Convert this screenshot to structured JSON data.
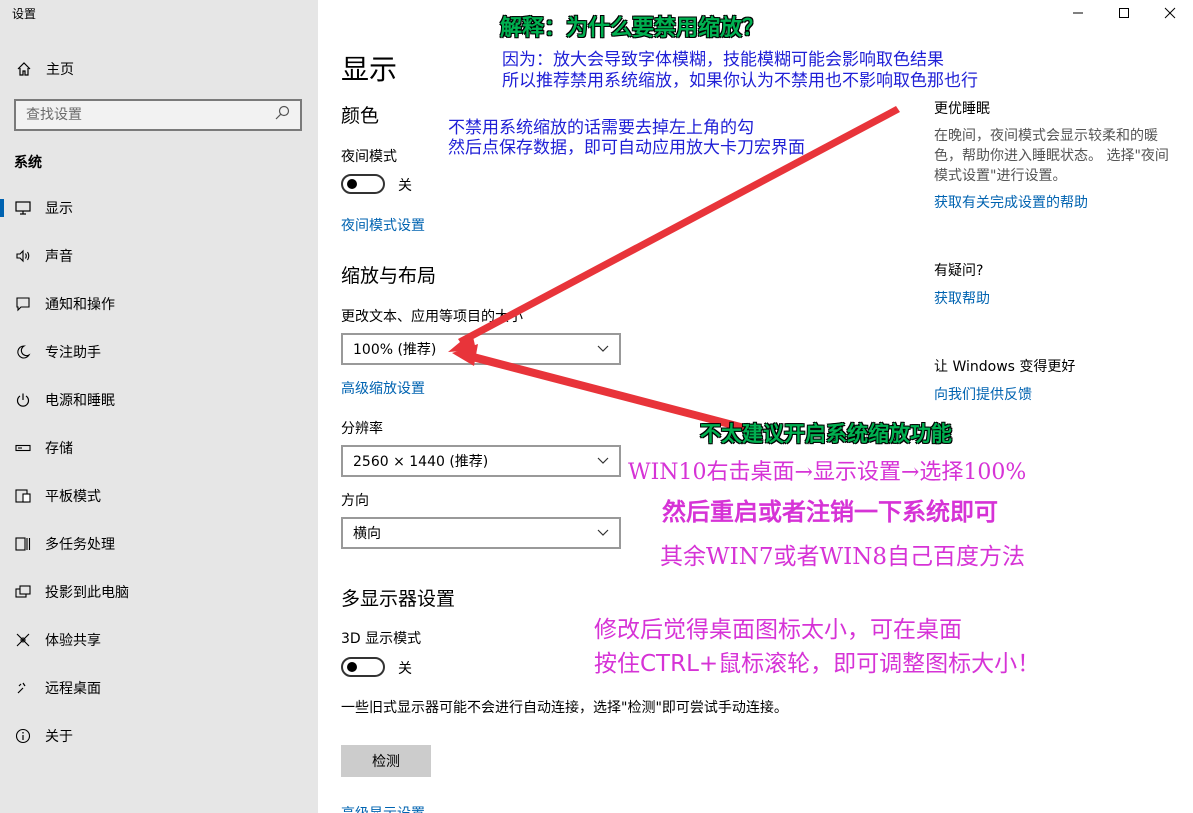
{
  "app": {
    "title": "设置"
  },
  "window": {
    "minimize_icon": "minimize-icon",
    "maximize_icon": "maximize-icon",
    "close_icon": "close-icon"
  },
  "sidebar": {
    "home_label": "主页",
    "search_placeholder": "查找设置",
    "section_label": "系统",
    "items": [
      {
        "label": "显示",
        "icon": "monitor-icon",
        "active": true
      },
      {
        "label": "声音",
        "icon": "speaker-icon"
      },
      {
        "label": "通知和操作",
        "icon": "notification-icon"
      },
      {
        "label": "专注助手",
        "icon": "moon-icon"
      },
      {
        "label": "电源和睡眠",
        "icon": "power-icon"
      },
      {
        "label": "存储",
        "icon": "storage-icon"
      },
      {
        "label": "平板模式",
        "icon": "tablet-icon"
      },
      {
        "label": "多任务处理",
        "icon": "multitask-icon"
      },
      {
        "label": "投影到此电脑",
        "icon": "project-icon"
      },
      {
        "label": "体验共享",
        "icon": "share-icon"
      },
      {
        "label": "远程桌面",
        "icon": "remote-icon"
      },
      {
        "label": "关于",
        "icon": "info-icon"
      }
    ]
  },
  "main": {
    "title": "显示",
    "color_heading": "颜色",
    "night_mode_label": "夜间模式",
    "night_mode_state": "关",
    "night_mode_settings_link": "夜间模式设置",
    "scale_heading": "缩放与布局",
    "scale_label": "更改文本、应用等项目的大小",
    "scale_value": "100% (推荐)",
    "advanced_scale_link": "高级缩放设置",
    "resolution_label": "分辨率",
    "resolution_value": "2560 × 1440 (推荐)",
    "orientation_label": "方向",
    "orientation_value": "横向",
    "multi_display_heading": "多显示器设置",
    "mode3d_label": "3D 显示模式",
    "mode3d_state": "关",
    "legacy_text": "一些旧式显示器可能不会进行自动连接，选择\"检测\"即可尝试手动连接。",
    "detect_button": "检测",
    "advanced_display_link": "高级显示设置"
  },
  "right": {
    "sleep_heading": "更优睡眠",
    "sleep_text": "在晚间，夜间模式会显示较柔和的暖色，帮助你进入睡眠状态。 选择\"夜间模式设置\"进行设置。",
    "sleep_link": "获取有关完成设置的帮助",
    "question_heading": "有疑问?",
    "help_link": "获取帮助",
    "improve_heading": "让 Windows 变得更好",
    "feedback_link": "向我们提供反馈"
  },
  "annotations": {
    "why_title": "解释：为什么要禁用缩放？",
    "why_line1": "因为：放大会导致字体模糊，技能模糊可能会影响取色结果",
    "why_line2": "所以推荐禁用系统缩放，如果你认为不禁用也不影响取色那也行",
    "tip_line1": "不禁用系统缩放的话需要去掉左上角的勾",
    "tip_line2": "然后点保存数据，即可自动应用放大卡刀宏界面",
    "recommend": "不太建议开启系统缩放功能",
    "win10": "WIN10右击桌面→显示设置→选择100%",
    "restart": "然后重启或者注销一下系统即可",
    "others": "其余WIN7或者WIN8自己百度方法",
    "after1": "修改后觉得桌面图标太小，可在桌面",
    "after2": "按住CTRL+鼠标滚轮，即可调整图标大小！"
  },
  "colors": {
    "accent": "#0063b1",
    "arrow": "#e8343a",
    "green": "#00b050",
    "blue": "#1f1fd6",
    "magenta": "#d633d6"
  }
}
